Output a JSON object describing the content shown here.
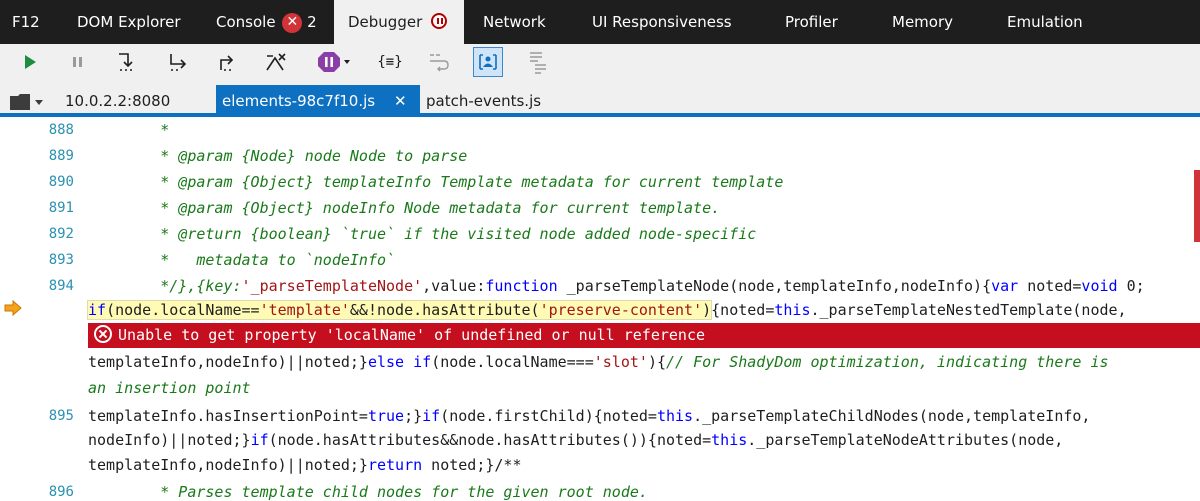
{
  "tabs": {
    "f12": "F12",
    "dom_explorer": "DOM Explorer",
    "console": "Console",
    "console_errors": "2",
    "debugger": "Debugger",
    "network": "Network",
    "ui_responsiveness": "UI Responsiveness",
    "profiler": "Profiler",
    "memory": "Memory",
    "emulation": "Emulation"
  },
  "toolbar": {
    "icons": [
      "play-icon",
      "pause-icon",
      "step-into-icon",
      "step-over-icon",
      "step-out-icon",
      "break-on-new-worker-icon",
      "exception-behavior-icon",
      "pretty-print-icon",
      "word-wrap-icon",
      "just-my-code-icon",
      "source-maps-icon"
    ],
    "pretty_print_label": "{≡}",
    "accent": "#0e70c0"
  },
  "files": {
    "host": "10.0.2.2:8080",
    "active_file": "elements-98c7f10.js",
    "close_glyph": "✕",
    "other_file": "patch-events.js"
  },
  "code": {
    "line_numbers": {
      "n888": "888",
      "n889": "889",
      "n890": "890",
      "n891": "891",
      "n892": "892",
      "n893": "893",
      "n894": "894",
      "n895": "895",
      "n896": "896"
    },
    "l888": "        *",
    "l889": "        * @param {Node} node Node to parse",
    "l890": "        * @param {Object} templateInfo Template metadata for current template",
    "l891": "        * @param {Object} nodeInfo Node metadata for current template.",
    "l892": "        * @return {boolean} `true` if the visited node added node-specific",
    "l893": "        *   metadata to `nodeInfo`",
    "l894": {
      "a": "        */},{key:",
      "b": "'_parseTemplateNode'",
      "c": ",value:",
      "d": "function",
      "e": " _parseTemplateNode(node,templateInfo,nodeInfo){",
      "f": "var",
      "g": " noted=",
      "h": "void",
      "i": " 0;"
    },
    "exec": {
      "a": "if",
      "b": "(node.localName==",
      "c": "'template'",
      "d": "&&!node.hasAttribute(",
      "e": "'preserve-content'",
      "f": ")",
      "g": "{noted=",
      "h": "this",
      "i": "._parseTemplateNestedTemplate(node,"
    },
    "error_message": "Unable to get property 'localName' of undefined or null reference",
    "w1": {
      "a": "templateInfo,nodeInfo)||noted;}",
      "b": "else if",
      "c": "(node.localName===",
      "d": "'slot'",
      "e": "){",
      "f": "// For ShadyDom optimization, indicating there is"
    },
    "w2": "an insertion point",
    "l895": {
      "a": "templateInfo.hasInsertionPoint=",
      "b": "true",
      "c": ";}",
      "d": "if",
      "e": "(node.firstChild){noted=",
      "f": "this",
      "g": "._parseTemplateChildNodes(node,templateInfo,"
    },
    "w3": {
      "a": "nodeInfo)||noted;}",
      "b": "if",
      "c": "(node.hasAttributes&&node.hasAttributes()){noted=",
      "d": "this",
      "e": "._parseTemplateNodeAttributes(node,"
    },
    "w4": {
      "a": "templateInfo,nodeInfo)||noted;}",
      "b": "return",
      "c": " noted;}/**"
    },
    "l896": "        * Parses template child nodes for the given root node."
  }
}
